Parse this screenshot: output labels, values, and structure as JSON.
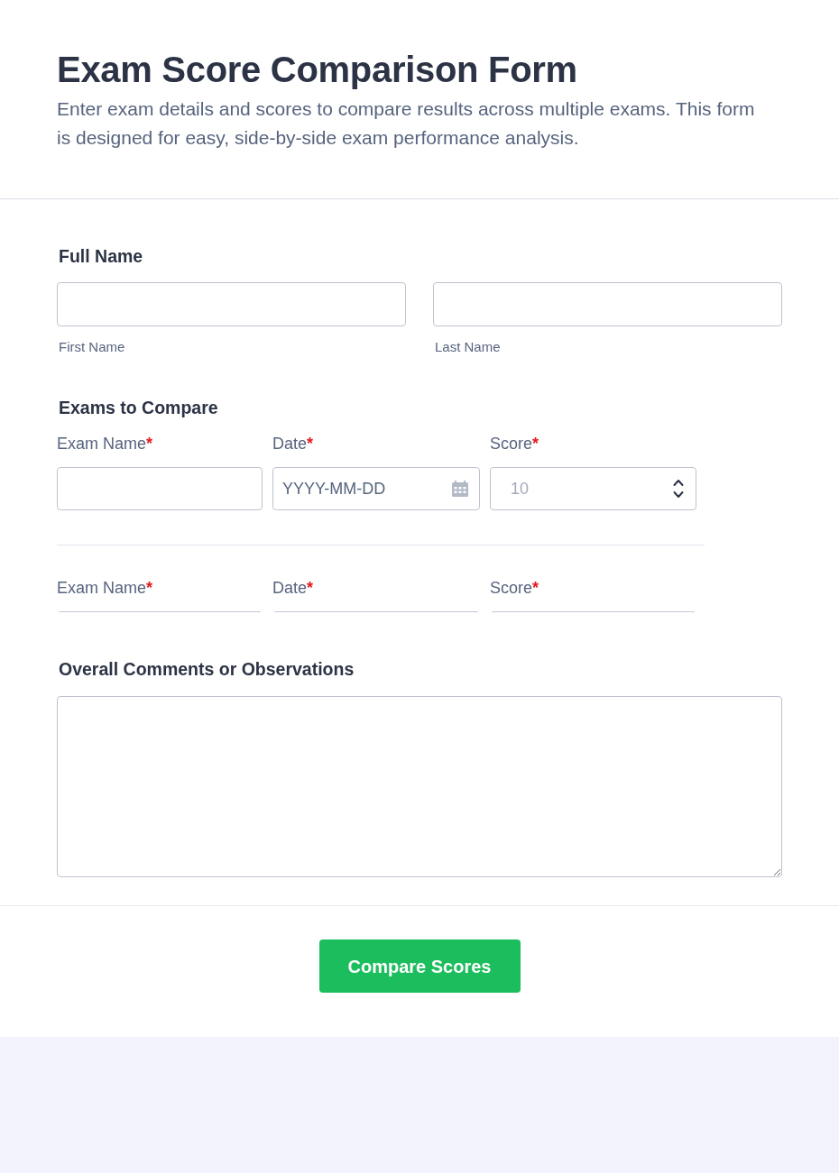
{
  "header": {
    "title": "Exam Score Comparison Form",
    "description": "Enter exam details and scores to compare results across multiple exams. This form is designed for easy, side-by-side exam performance analysis."
  },
  "full_name": {
    "label": "Full Name",
    "fields": [
      {
        "sublabel": "First Name"
      },
      {
        "sublabel": "Last Name"
      }
    ]
  },
  "exams": {
    "label": "Exams to Compare",
    "rows": [
      {
        "cut_off": false,
        "columns": [
          {
            "kind": "text",
            "label": "Exam Name",
            "required_mark": "*"
          },
          {
            "kind": "date",
            "label": "Date",
            "required_mark": "*",
            "placeholder": "YYYY-MM-DD"
          },
          {
            "kind": "number",
            "label": "Score",
            "required_mark": "*",
            "placeholder": "10"
          }
        ]
      },
      {
        "cut_off": true,
        "columns": [
          {
            "kind": "text",
            "label": "Exam Name",
            "required_mark": "*"
          },
          {
            "kind": "date",
            "label": "Date",
            "required_mark": "*"
          },
          {
            "kind": "number",
            "label": "Score",
            "required_mark": "*"
          }
        ]
      }
    ]
  },
  "comments": {
    "label": "Overall Comments or Observations"
  },
  "submit": {
    "label": "Compare Scores"
  }
}
